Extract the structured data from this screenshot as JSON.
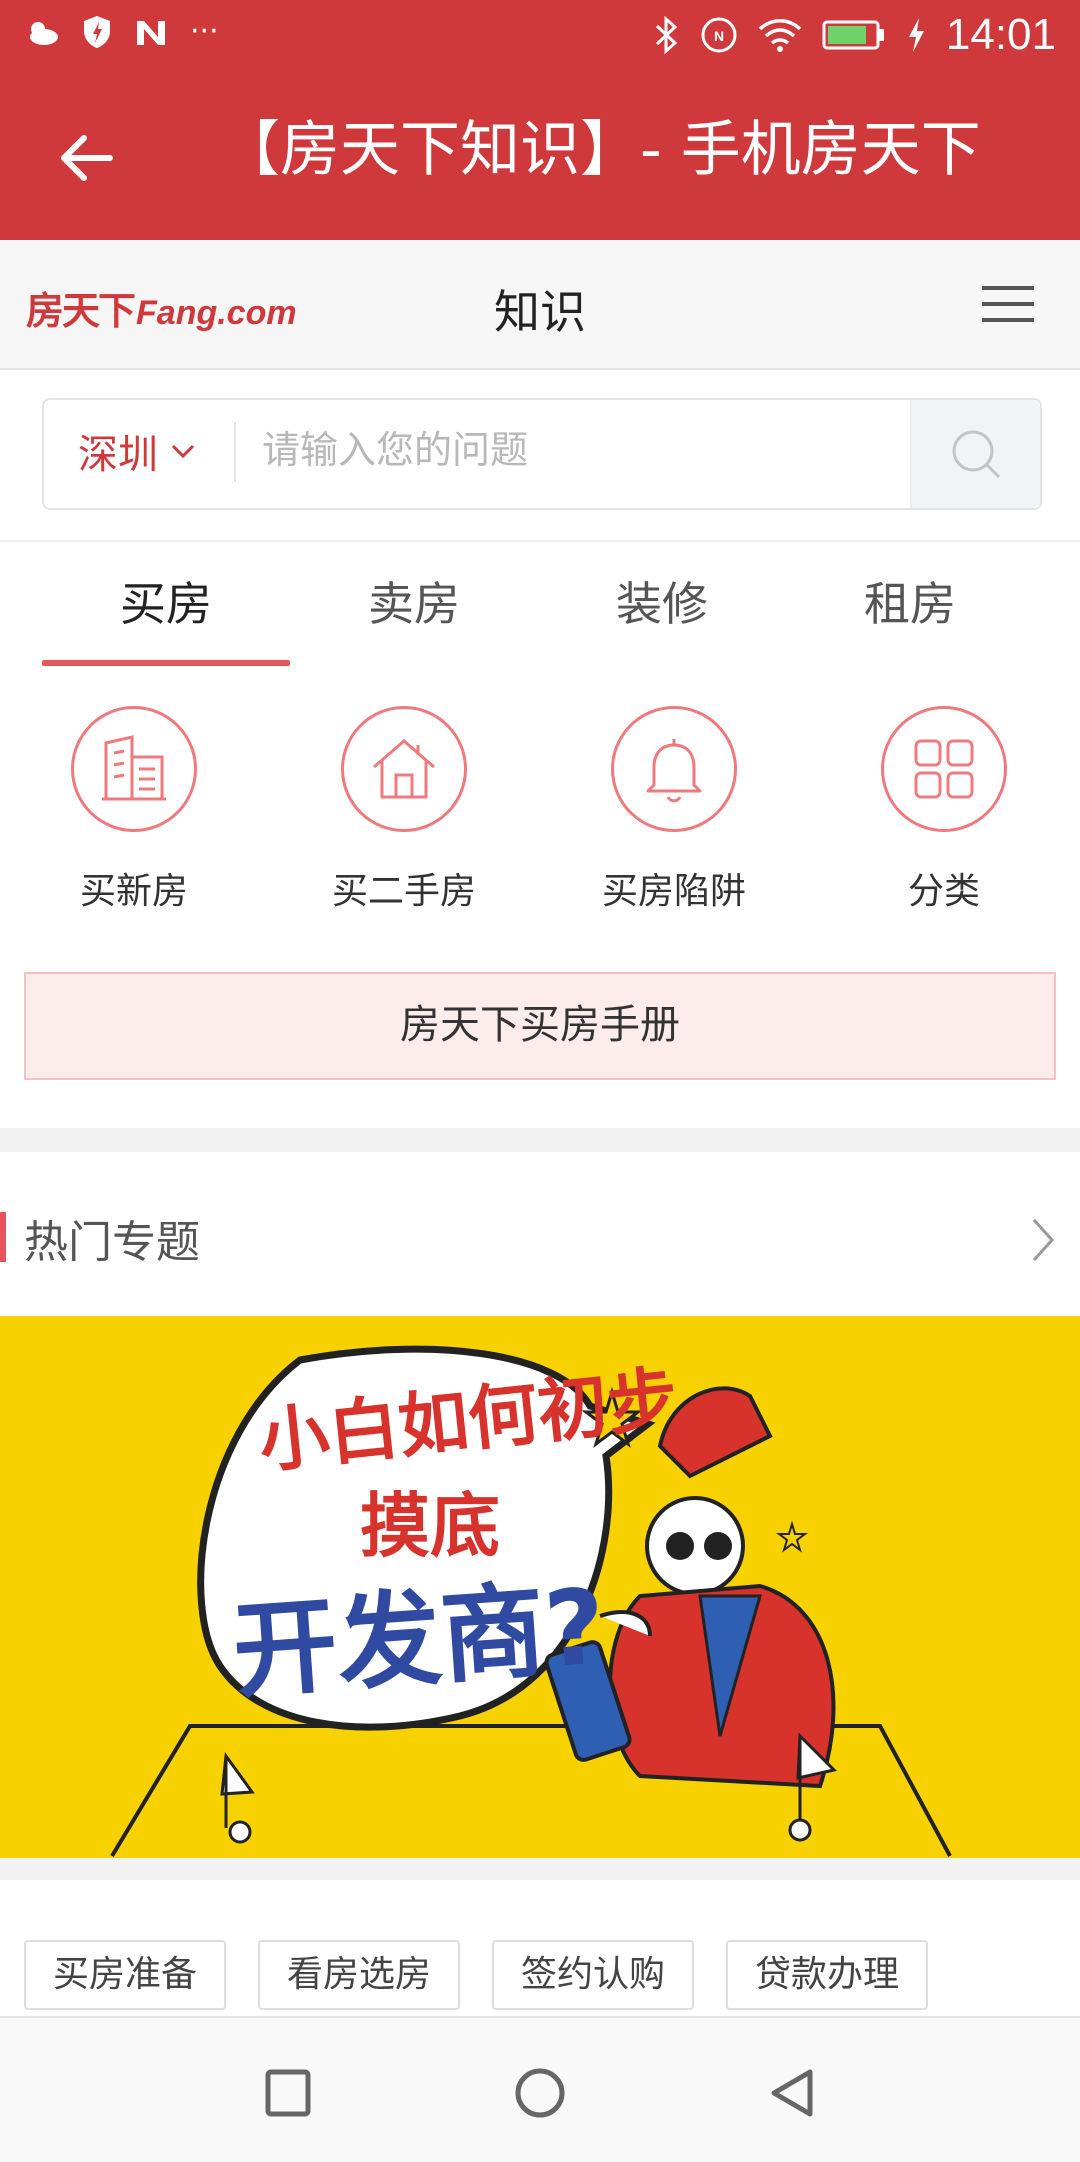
{
  "status_bar": {
    "time": "14:01",
    "left_icons": [
      "weather-icon",
      "shield-icon",
      "n-app-icon",
      "more-dots-icon"
    ],
    "right_icons": [
      "bluetooth-icon",
      "nfc-icon",
      "wifi-icon",
      "battery-icon",
      "charging-icon"
    ],
    "more": "···"
  },
  "app_bar": {
    "title": "【房天下知识】- 手机房天下"
  },
  "site_header": {
    "logo_cn": "房天下",
    "logo_en": "Fang.com",
    "page_title": "知识"
  },
  "search": {
    "city": "深圳",
    "placeholder": "请输入您的问题"
  },
  "tabs": [
    {
      "label": "买房",
      "active": true
    },
    {
      "label": "卖房",
      "active": false
    },
    {
      "label": "装修",
      "active": false
    },
    {
      "label": "租房",
      "active": false
    }
  ],
  "categories": [
    {
      "label": "买新房",
      "icon": "buildings-icon"
    },
    {
      "label": "买二手房",
      "icon": "house-icon"
    },
    {
      "label": "买房陷阱",
      "icon": "bell-icon"
    },
    {
      "label": "分类",
      "icon": "grid-icon"
    }
  ],
  "handbook": {
    "label": "房天下买房手册"
  },
  "hot_topics": {
    "title": "热门专题",
    "banner_text": {
      "line1": "小白如何初步",
      "line2": "摸底",
      "line3": "开发商?"
    }
  },
  "chips": [
    "买房准备",
    "看房选房",
    "签约认购",
    "贷款办理"
  ],
  "colors": {
    "brand_red": "#d0393c",
    "accent_red": "#e8545b",
    "banner_yellow": "#f7d100"
  }
}
